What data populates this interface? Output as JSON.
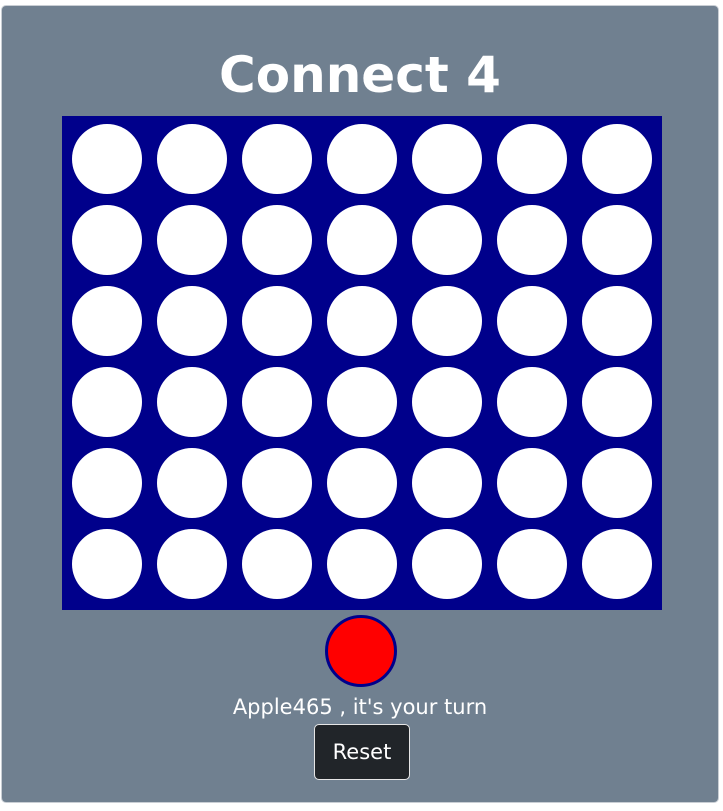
{
  "game": {
    "title": "Connect 4",
    "rows": 6,
    "columns": 7,
    "board": [
      [
        "empty",
        "empty",
        "empty",
        "empty",
        "empty",
        "empty",
        "empty"
      ],
      [
        "empty",
        "empty",
        "empty",
        "empty",
        "empty",
        "empty",
        "empty"
      ],
      [
        "empty",
        "empty",
        "empty",
        "empty",
        "empty",
        "empty",
        "empty"
      ],
      [
        "empty",
        "empty",
        "empty",
        "empty",
        "empty",
        "empty",
        "empty"
      ],
      [
        "empty",
        "empty",
        "empty",
        "empty",
        "empty",
        "empty",
        "empty"
      ],
      [
        "empty",
        "empty",
        "empty",
        "empty",
        "empty",
        "empty",
        "empty"
      ]
    ],
    "current_player": {
      "name": "Apple465",
      "color": "#ff0000"
    },
    "status_text": "Apple465 , it's your turn",
    "reset_label": "Reset"
  },
  "colors": {
    "background": "#708090",
    "board": "#00008b",
    "empty_slot": "#ffffff",
    "button": "#212529"
  }
}
